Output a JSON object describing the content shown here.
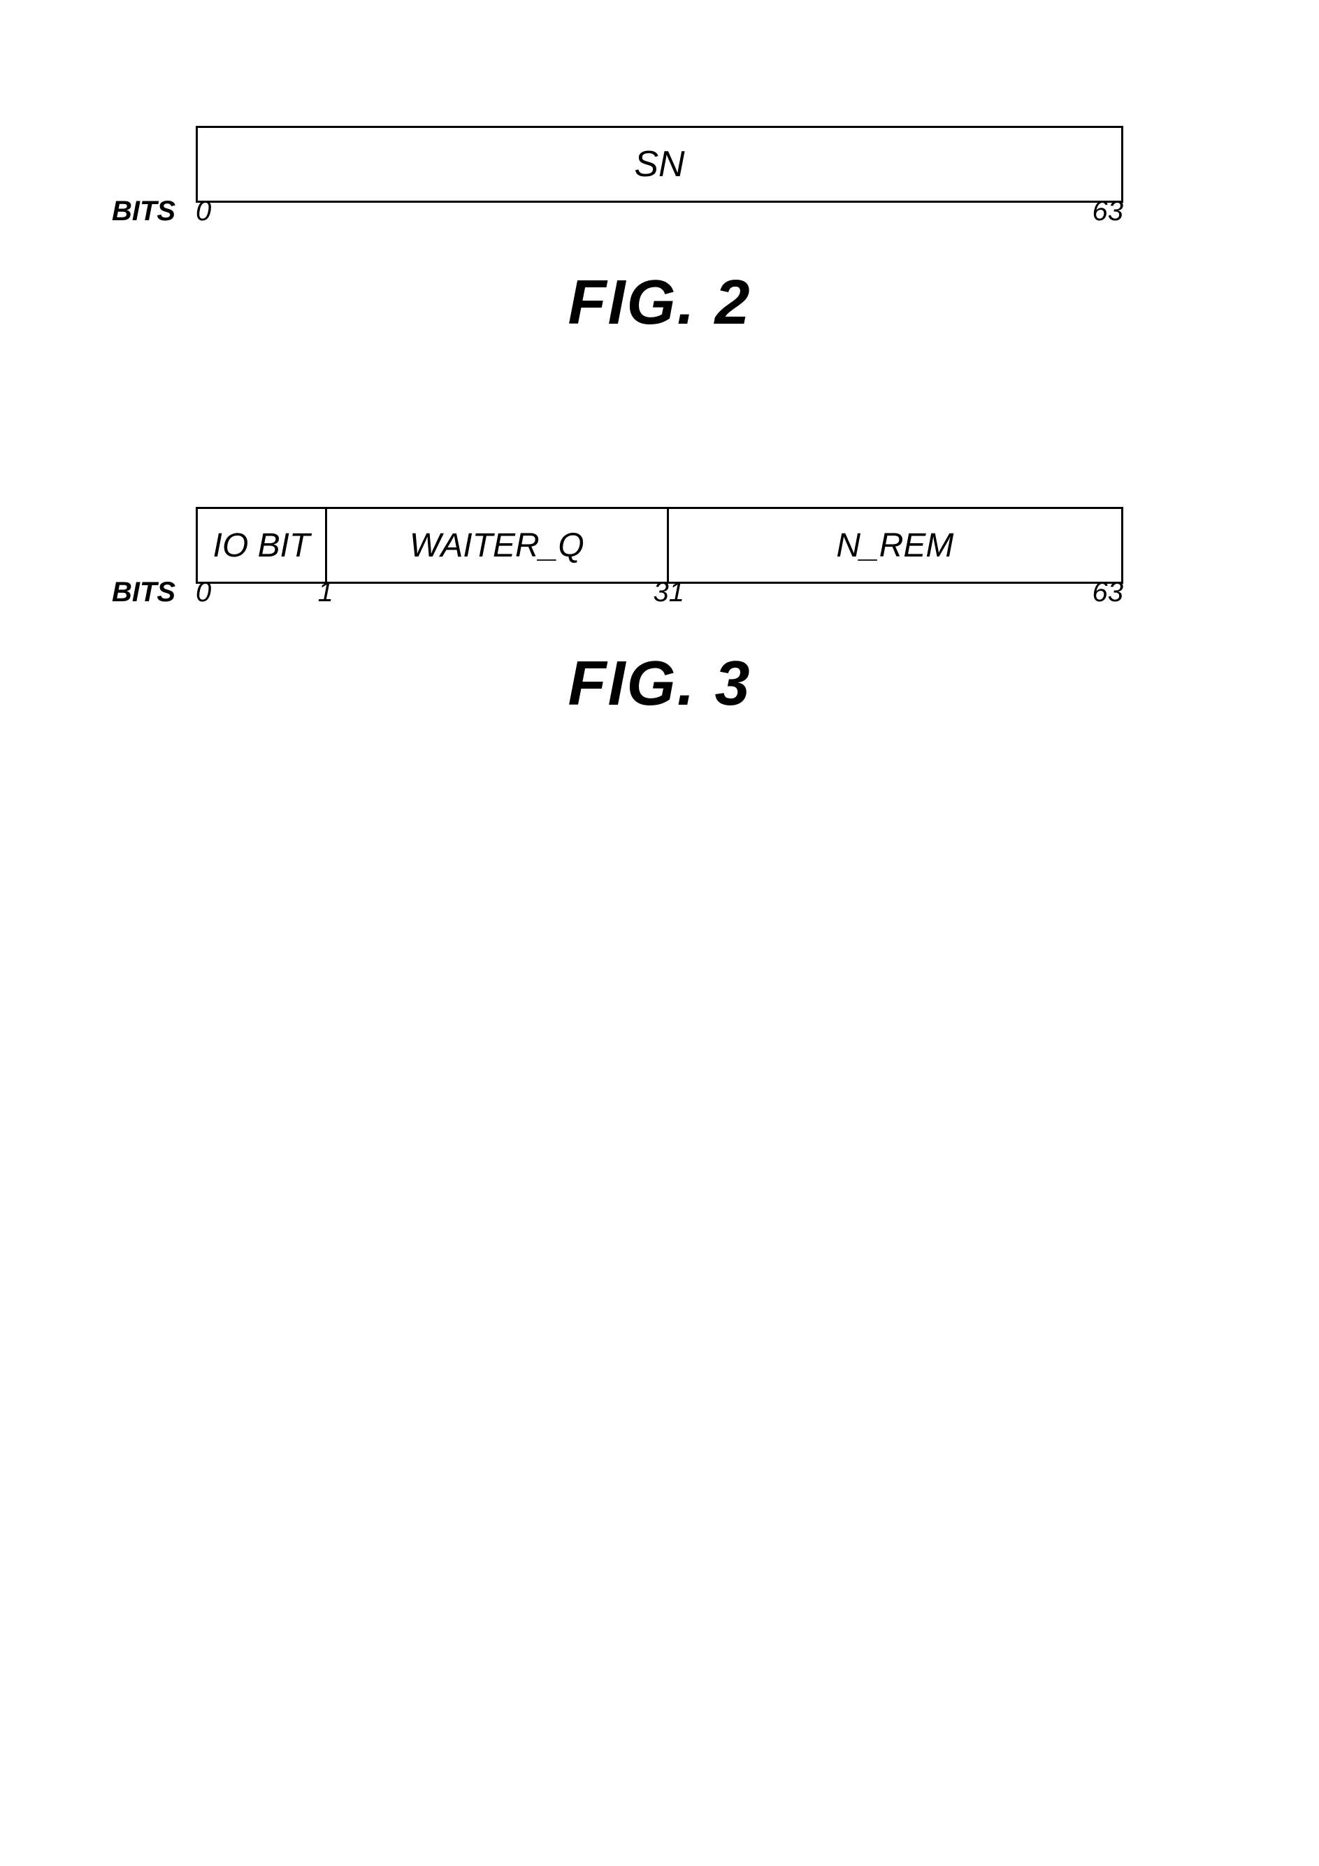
{
  "fig2": {
    "title": "FIG. 2",
    "register": {
      "field": "SN"
    },
    "bits_label": "BITS",
    "bit_start": "0",
    "bit_end": "63"
  },
  "fig3": {
    "title": "FIG. 3",
    "register": {
      "col1": "IO BIT",
      "col2": "WAITER_Q",
      "col3": "N_REM"
    },
    "bits_label": "BITS",
    "bit_start": "0",
    "bit_mid1": "1",
    "bit_mid2": "31",
    "bit_end": "63"
  }
}
